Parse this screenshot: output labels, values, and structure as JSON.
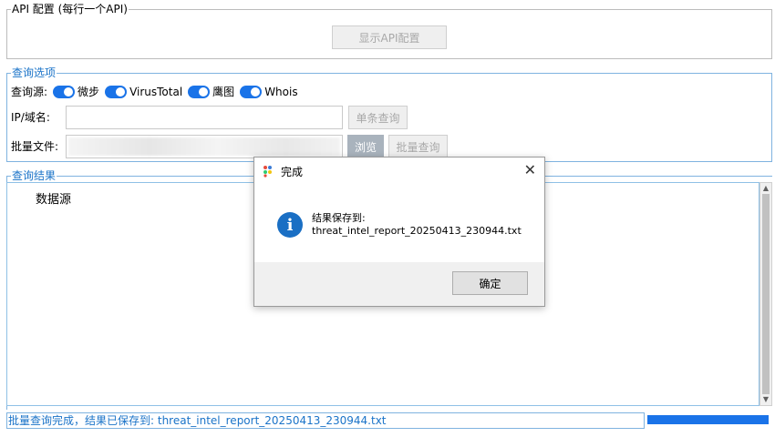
{
  "api_config": {
    "legend": "API 配置 (每行一个API)",
    "show_button": "显示API配置"
  },
  "query_options": {
    "legend": "查询选项",
    "source_label": "查询源:",
    "sources": [
      {
        "label": "微步",
        "enabled": true
      },
      {
        "label": "VirusTotal",
        "enabled": true
      },
      {
        "label": "鹰图",
        "enabled": true
      },
      {
        "label": "Whois",
        "enabled": true
      }
    ],
    "ip_label": "IP/域名:",
    "ip_value": "",
    "single_query_button": "单条查询",
    "batch_file_label": "批量文件:",
    "browse_button": "浏览",
    "batch_query_button": "批量查询"
  },
  "results": {
    "legend": "查询结果",
    "column_header": "数据源"
  },
  "status": {
    "message": "批量查询完成，结果已保存到: threat_intel_report_20250413_230944.txt",
    "progress": 1.0
  },
  "dialog": {
    "title": "完成",
    "line1": "结果保存到:",
    "line2": "threat_intel_report_20250413_230944.txt",
    "ok_button": "确定"
  },
  "colors": {
    "accent": "#1a73e8",
    "info_icon": "#1a6fc4"
  }
}
